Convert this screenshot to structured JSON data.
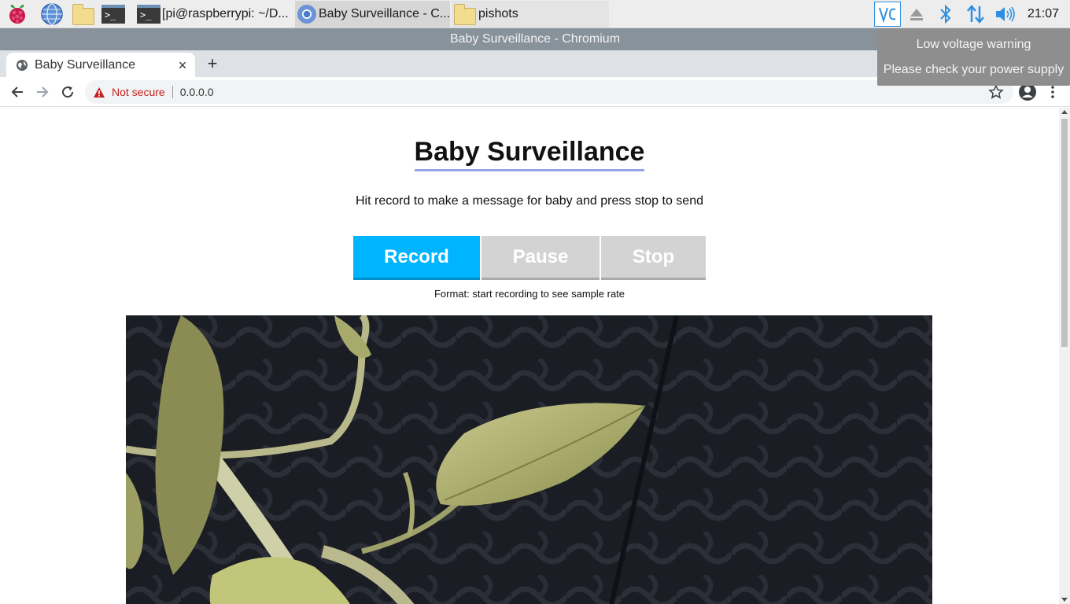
{
  "taskbar": {
    "tasks": [
      {
        "label": "[pi@raspberrypi: ~/D..."
      },
      {
        "label": "Baby Surveillance - C..."
      },
      {
        "label": "pishots"
      }
    ],
    "clock": "21:07"
  },
  "window": {
    "title": "Baby Surveillance - Chromium"
  },
  "notification": {
    "line1": "Low voltage warning",
    "line2": "Please check your power supply"
  },
  "browser": {
    "tab_title": "Baby Surveillance",
    "tab_close": "×",
    "new_tab": "+",
    "security_label": "Not secure",
    "url": "0.0.0.0"
  },
  "page": {
    "title": "Baby Surveillance",
    "subtitle": "Hit record to make a message for baby and press stop to send",
    "buttons": {
      "record": "Record",
      "pause": "Pause",
      "stop": "Stop"
    },
    "format": "Format: start recording to see sample rate"
  },
  "colors": {
    "record_accent": "#00b4ff",
    "disabled_button": "#d3d3d3",
    "title_underline": "#9aa5e8",
    "window_titlebar": "#87929b",
    "notification_bg": "#8e8e8e"
  }
}
